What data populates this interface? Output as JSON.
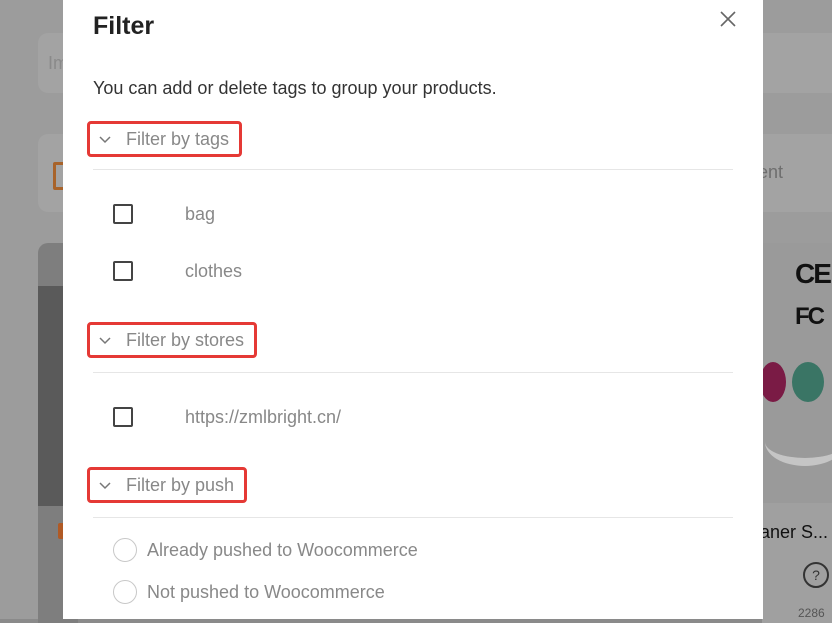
{
  "background": {
    "search_placeholder": "Im",
    "toolbar_text": "ent",
    "card_right_title": "aner S...",
    "card_right_count": "2286",
    "help_icon": "question-circle-icon"
  },
  "modal": {
    "title": "Filter",
    "close_icon": "close-icon",
    "description": "You can add or delete tags to group your products.",
    "sections": {
      "tags": {
        "label": "Filter by tags",
        "options": [
          "bag",
          "clothes"
        ]
      },
      "stores": {
        "label": "Filter by stores",
        "options": [
          "https://zmlbright.cn/"
        ]
      },
      "push": {
        "label": "Filter by push",
        "options": [
          "Already pushed to Woocommerce",
          "Not pushed to Woocommerce"
        ]
      }
    }
  },
  "colors": {
    "highlight_border": "#e53935",
    "muted_text": "#888888"
  }
}
